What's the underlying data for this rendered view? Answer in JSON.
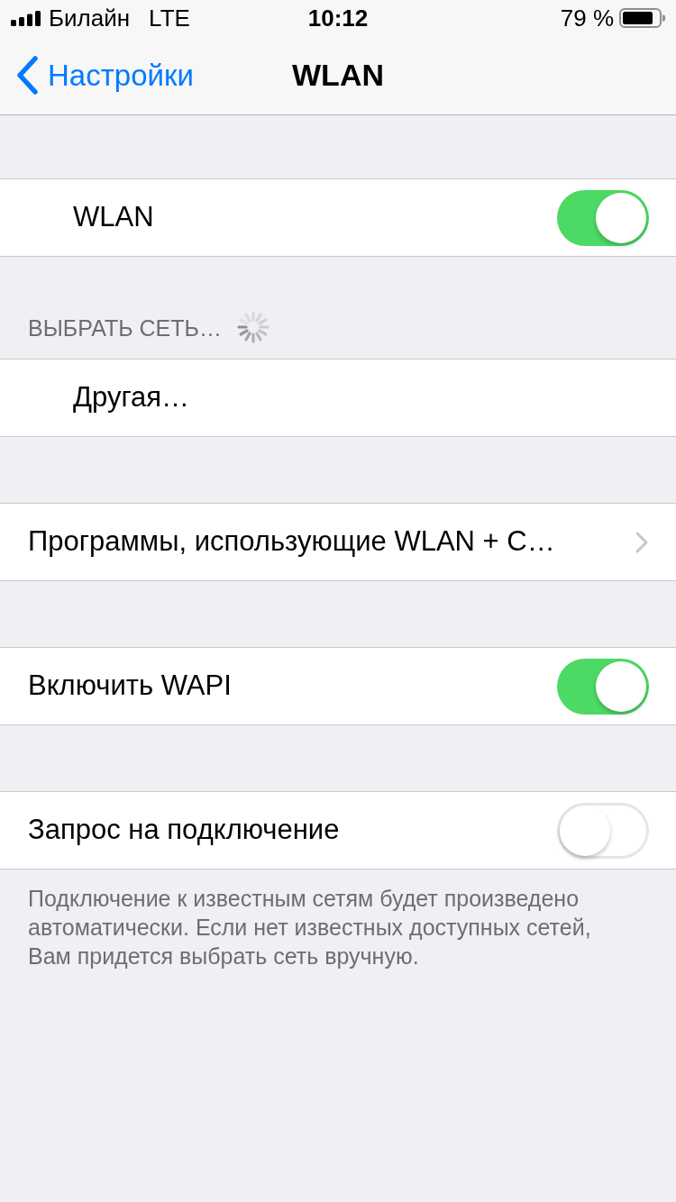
{
  "status_bar": {
    "carrier": "Билайн",
    "network": "LTE",
    "time": "10:12",
    "battery": "79 %"
  },
  "nav_bar": {
    "back": "Настройки",
    "title": "WLAN"
  },
  "sections": [
    {
      "rows": [
        {
          "kind": "main_toggle",
          "label": "WLAN",
          "on": true
        }
      ]
    },
    {
      "header": "ВЫБРАТЬ СЕТЬ…",
      "loading": true,
      "rows": [
        {
          "kind": "network",
          "label": "Другая…"
        }
      ]
    },
    {
      "rows": [
        {
          "kind": "link",
          "label": "Программы, использующие WLAN + С…"
        }
      ]
    },
    {
      "rows": [
        {
          "kind": "toggle",
          "label": "Включить WAPI",
          "on": true
        }
      ]
    },
    {
      "rows": [
        {
          "kind": "toggle",
          "label": "Запрос на подключение",
          "on": false
        }
      ],
      "footer": "Подключение к известным сетям будет произведено автоматически. Если нет известных доступных сетей, Вам придется выбрать сеть вручную."
    }
  ]
}
